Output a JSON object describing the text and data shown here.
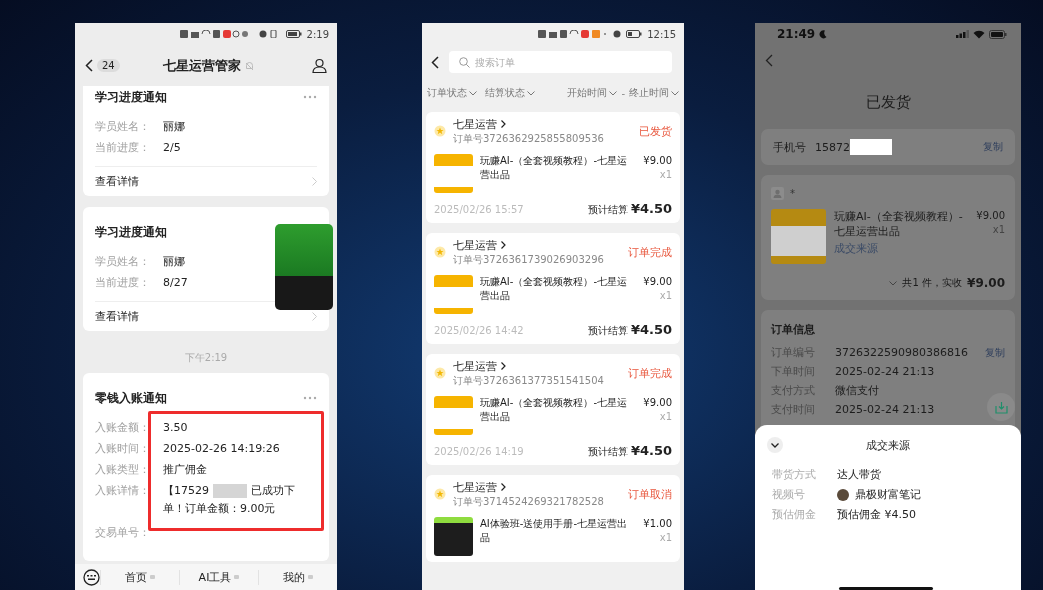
{
  "chat_screen": {
    "status_bar": {
      "time": "2:19"
    },
    "header": {
      "back_count": "24",
      "title": "七星运营管家"
    },
    "notices": [
      {
        "title": "学习进度通知",
        "fields": [
          {
            "label": "学员姓名：",
            "value": "丽娜"
          },
          {
            "label": "当前进度：",
            "value": "2/5"
          }
        ],
        "link": "查看详情"
      },
      {
        "title": "学习进度通知",
        "fields": [
          {
            "label": "学员姓名：",
            "value": "丽娜"
          },
          {
            "label": "当前进度：",
            "value": "8/27"
          }
        ],
        "link": "查看详情"
      }
    ],
    "timestamp": "下午2:19",
    "payment_notice": {
      "title": "零钱入账通知",
      "fields": [
        {
          "label": "入账金额：",
          "value": "3.50"
        },
        {
          "label": "入账时间：",
          "value": "2025-02-26 14:19:26"
        },
        {
          "label": "入账类型：",
          "value": "推广佣金"
        }
      ],
      "detail": {
        "label": "入账详情：",
        "prefix": "【17529",
        "rest": "已成功下单！订单金额：9.00元"
      },
      "trade_no_label": "交易单号："
    },
    "menu": [
      "首页",
      "AI工具",
      "我的"
    ]
  },
  "orders_screen": {
    "status_bar": {
      "time": "12:15"
    },
    "search": {
      "placeholder": "搜索订单"
    },
    "filters": [
      "订单状态",
      "结算状态",
      "开始时间",
      "终止时间"
    ],
    "range_separator": "-",
    "orders": [
      {
        "shop": "七星运营",
        "order_no": "订单号3726362925855809536",
        "status": "已发货",
        "kind": "course",
        "product": "玩赚AI-（全套视频教程）-七星运营出品",
        "price": "¥9.00",
        "qty": "x1",
        "date": "2025/02/26 15:57",
        "settle_label": "预计结算",
        "settle": "¥4.50"
      },
      {
        "shop": "七星运营",
        "order_no": "订单号3726361739026903296",
        "status": "订单完成",
        "kind": "course",
        "product": "玩赚AI-（全套视频教程）-七星运营出品",
        "price": "¥9.00",
        "qty": "x1",
        "date": "2025/02/26 14:42",
        "settle_label": "预计结算",
        "settle": "¥4.50"
      },
      {
        "shop": "七星运营",
        "order_no": "订单号3726361377351541504",
        "status": "订单完成",
        "kind": "course",
        "product": "玩赚AI-（全套视频教程）-七星运营出品",
        "price": "¥9.00",
        "qty": "x1",
        "date": "2025/02/26 14:19",
        "settle_label": "预计结算",
        "settle": "¥4.50"
      },
      {
        "shop": "七星运营",
        "order_no": "订单号3714524269321782528",
        "status": "订单取消",
        "kind": "manual",
        "product": "AI体验班-送使用手册-七星运营出品",
        "price": "¥1.00",
        "qty": "x1"
      }
    ]
  },
  "order_detail_screen": {
    "status_bar": {
      "time": "21:49"
    },
    "title": "已发货",
    "phone": {
      "label": "手机号",
      "value": "15872",
      "action": "复制"
    },
    "product": {
      "buyer": "*",
      "name": "玩赚AI-（全套视频教程）-七星运营出品",
      "price": "¥9.00",
      "qty": "x1",
      "source_link": "成交来源",
      "summary": "共1 件，实收",
      "total": "¥9.00"
    },
    "order_info": {
      "title": "订单信息",
      "rows": [
        {
          "label": "订单编号",
          "value": "3726322590980386816",
          "action": "复制"
        },
        {
          "label": "下单时间",
          "value": "2025-02-24 21:13"
        },
        {
          "label": "支付方式",
          "value": "微信支付"
        },
        {
          "label": "支付时间",
          "value": "2025-02-24 21:13"
        }
      ]
    },
    "sheet": {
      "title": "成交来源",
      "rows": [
        {
          "kind": "text",
          "label": "带货方式",
          "value": "达人带货"
        },
        {
          "kind": "account",
          "label": "视频号",
          "value": "鼎极财富笔记"
        },
        {
          "kind": "text",
          "label": "预估佣金",
          "value": "预估佣金 ¥4.50"
        }
      ]
    }
  }
}
